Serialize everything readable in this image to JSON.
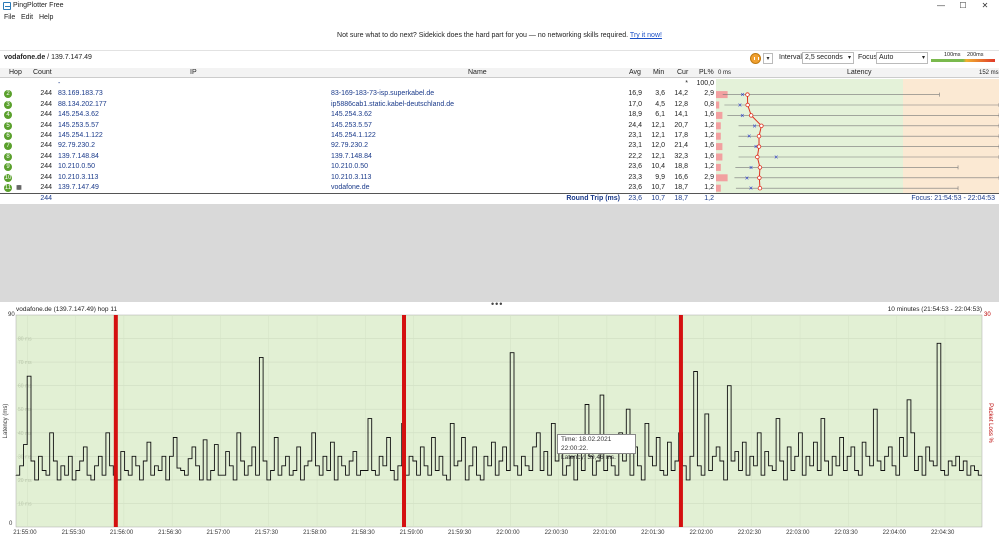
{
  "window": {
    "title": "PingPlotter Free",
    "minimize": "—",
    "maximize": "☐",
    "close": "✕"
  },
  "menu": {
    "file": "File",
    "edit": "Edit",
    "help": "Help"
  },
  "promo": {
    "text": "Not sure what to do next? Sidekick does the hard part for you — no networking skills required.",
    "link": "Try it now!"
  },
  "toolbar": {
    "target_name": "vodafone.de",
    "target_ip": " / 139.7.147.49",
    "interval_label": "Interval",
    "interval_value": "2,5 seconds",
    "focus_label": "Focus",
    "focus_value": "Auto",
    "legend_100": "100ms",
    "legend_200": "200ms"
  },
  "grid": {
    "headers": {
      "hop": "Hop",
      "count": "Count",
      "ip": "IP",
      "name": "Name",
      "avg": "Avg",
      "min": "Min",
      "cur": "Cur",
      "pl": "PL%",
      "zero": "0 ms",
      "latency": "Latency",
      "max": "152 ms"
    },
    "rows": [
      {
        "hop": "",
        "count": "",
        "ip": "-",
        "name": "",
        "avg": "",
        "min": "",
        "cur": "*",
        "pl": "100,0",
        "ms": null
      },
      {
        "hop": "2",
        "count": "244",
        "ip": "83.169.183.73",
        "name": "83-169-183-73-isp.superkabel.de",
        "avg": "16,9",
        "min": "3,6",
        "cur": "14,2",
        "pl": "2,9",
        "ms": {
          "avg": 16.9,
          "min": 3.6,
          "cur": 14.2,
          "max": 120,
          "pl": 2.9
        }
      },
      {
        "hop": "3",
        "count": "244",
        "ip": "88.134.202.177",
        "name": "ip5886cab1.static.kabel-deutschland.de",
        "avg": "17,0",
        "min": "4,5",
        "cur": "12,8",
        "pl": "0,8",
        "ms": {
          "avg": 17.0,
          "min": 4.5,
          "cur": 12.8,
          "max": 180,
          "pl": 0.8
        }
      },
      {
        "hop": "4",
        "count": "244",
        "ip": "145.254.3.62",
        "name": "145.254.3.62",
        "avg": "18,9",
        "min": "6,1",
        "cur": "14,1",
        "pl": "1,6",
        "ms": {
          "avg": 18.9,
          "min": 6.1,
          "cur": 14.1,
          "max": 230,
          "pl": 1.6
        }
      },
      {
        "hop": "5",
        "count": "244",
        "ip": "145.253.5.57",
        "name": "145.253.5.57",
        "avg": "24,4",
        "min": "12,1",
        "cur": "20,7",
        "pl": "1,2",
        "ms": {
          "avg": 24.4,
          "min": 12.1,
          "cur": 20.7,
          "max": 200,
          "pl": 1.2
        }
      },
      {
        "hop": "6",
        "count": "244",
        "ip": "145.254.1.122",
        "name": "145.254.1.122",
        "avg": "23,1",
        "min": "12,1",
        "cur": "17,8",
        "pl": "1,2",
        "ms": {
          "avg": 23.1,
          "min": 12.1,
          "cur": 17.8,
          "max": 170,
          "pl": 1.2
        }
      },
      {
        "hop": "7",
        "count": "244",
        "ip": "92.79.230.2",
        "name": "92.79.230.2",
        "avg": "23,1",
        "min": "12,0",
        "cur": "21,4",
        "pl": "1,6",
        "ms": {
          "avg": 23.1,
          "min": 12.0,
          "cur": 21.4,
          "max": 200,
          "pl": 1.6
        }
      },
      {
        "hop": "8",
        "count": "244",
        "ip": "139.7.148.84",
        "name": "139.7.148.84",
        "avg": "22,2",
        "min": "12,1",
        "cur": "32,3",
        "pl": "1,6",
        "ms": {
          "avg": 22.2,
          "min": 12.1,
          "cur": 32.3,
          "max": 200,
          "pl": 1.6
        }
      },
      {
        "hop": "9",
        "count": "244",
        "ip": "10.210.0.50",
        "name": "10.210.0.50",
        "avg": "23,6",
        "min": "10,4",
        "cur": "18,8",
        "pl": "1,2",
        "ms": {
          "avg": 23.6,
          "min": 10.4,
          "cur": 18.8,
          "max": 130,
          "pl": 1.2
        }
      },
      {
        "hop": "10",
        "count": "244",
        "ip": "10.210.3.113",
        "name": "10.210.3.113",
        "avg": "23,3",
        "min": "9,9",
        "cur": "16,6",
        "pl": "2,9",
        "ms": {
          "avg": 23.3,
          "min": 9.9,
          "cur": 16.6,
          "max": 160,
          "pl": 2.9
        }
      },
      {
        "hop": "11",
        "count": "244",
        "ip": "139.7.147.49",
        "name": "vodafone.de",
        "avg": "23,6",
        "min": "10,7",
        "cur": "18,7",
        "pl": "1,2",
        "ms": {
          "avg": 23.6,
          "min": 10.7,
          "cur": 18.7,
          "max": 130,
          "pl": 1.2
        }
      }
    ],
    "summary": {
      "count": "244",
      "label": "Round Trip (ms)",
      "avg": "23,6",
      "min": "10,7",
      "cur": "18,7",
      "pl": "1,2",
      "focus": "Focus: 21:54:53 - 22:04:53"
    }
  },
  "graph": {
    "title": "vodafone.de (139.7.147.49) hop 11",
    "range": "10 minutes (21:54:53 - 22:04:53)",
    "y_left_label": "Latency (ms)",
    "y_right_label": "Packet Loss %",
    "y_left_top": "90",
    "y_left_bottom": "0",
    "y_right_top": "30",
    "gridlines": [
      "80 ms",
      "70 ms",
      "60 ms",
      "50 ms",
      "40 ms",
      "30 ms",
      "20 ms",
      "10 ms"
    ],
    "x_ticks": [
      "21:55:00",
      "21:55:30",
      "21:56:00",
      "21:56:30",
      "21:57:00",
      "21:57:30",
      "21:58:00",
      "21:58:30",
      "21:59:00",
      "21:59:30",
      "22:00:00",
      "22:00:30",
      "22:01:00",
      "22:01:30",
      "22:02:00",
      "22:02:30",
      "22:03:00",
      "22:03:30",
      "22:04:00",
      "22:04:30"
    ],
    "tooltip_time": "Time: 18.02.2021 22:00:22.",
    "tooltip_latency": "Latency: 39,46 ms."
  },
  "chart_data": {
    "type": "line",
    "title": "vodafone.de (139.7.147.49) hop 11",
    "xlabel": "",
    "ylabel": "Latency (ms)",
    "ylim": [
      0,
      90
    ],
    "x_range": [
      "21:54:53",
      "22:04:53"
    ],
    "interval_seconds": 2.5,
    "packet_loss_events_seconds_after_start": [
      62,
      241,
      413
    ],
    "series": [
      {
        "values": [
          22,
          26,
          35,
          64,
          28,
          20,
          30,
          24,
          22,
          40,
          28,
          20,
          26,
          22,
          30,
          20,
          24,
          28,
          34,
          22,
          20,
          26,
          30,
          22,
          40,
          26,
          22,
          20,
          32,
          24,
          22,
          30,
          26,
          20,
          28,
          36,
          22,
          26,
          24,
          30,
          20,
          30,
          38,
          25,
          24,
          22,
          29,
          34,
          26,
          20,
          37,
          20,
          24,
          35,
          22,
          22,
          32,
          26,
          20,
          40,
          28,
          22,
          26,
          34,
          22,
          72,
          28,
          20,
          24,
          38,
          22,
          26,
          30,
          22,
          24,
          34,
          20,
          26,
          28,
          40,
          26,
          22,
          30,
          24,
          36,
          20,
          30,
          26,
          22,
          28,
          32,
          22,
          24,
          24,
          46,
          24,
          22,
          30,
          26,
          38,
          24,
          20,
          26,
          44,
          22,
          30,
          28,
          22,
          34,
          26,
          22,
          38,
          24,
          30,
          22,
          20,
          44,
          26,
          28,
          38,
          20,
          26,
          34,
          22,
          20,
          30,
          26,
          36,
          22,
          28,
          34,
          24,
          74,
          26,
          22,
          30,
          26,
          24,
          34,
          40,
          24,
          32,
          22,
          44,
          28,
          34,
          22,
          26,
          30,
          20,
          36,
          24,
          52,
          30,
          22,
          28,
          56,
          24,
          30,
          26,
          22,
          40,
          28,
          50,
          22,
          34,
          26,
          20,
          44,
          30,
          26,
          38,
          24,
          22,
          36,
          24,
          28,
          40,
          26,
          20,
          30,
          66,
          26,
          22,
          48,
          24,
          30,
          34,
          28,
          20,
          60,
          28,
          32,
          24,
          36,
          22,
          30,
          26,
          40,
          22,
          32,
          26,
          24,
          46,
          28,
          20,
          34,
          24,
          30,
          40,
          22,
          30,
          26,
          36,
          24,
          46,
          28,
          22,
          30,
          26,
          38,
          24,
          30,
          34,
          24,
          22,
          36,
          30,
          26,
          50,
          28,
          24,
          30,
          34,
          26,
          22,
          38,
          30,
          54,
          40,
          24,
          30,
          22,
          34,
          28,
          26,
          78,
          24,
          22,
          28,
          26,
          30,
          24,
          28,
          22,
          26,
          24,
          22
        ]
      }
    ]
  }
}
